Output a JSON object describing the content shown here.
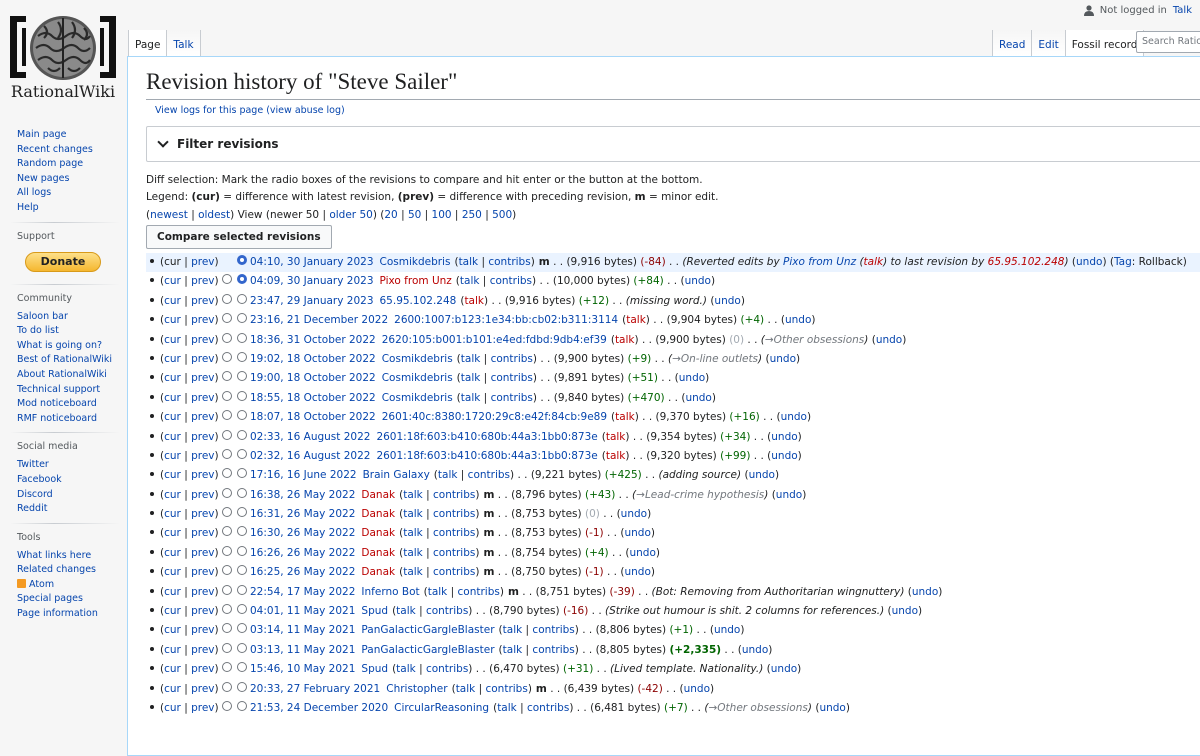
{
  "site": {
    "name": "RationalWiki"
  },
  "personal": {
    "status": "Not logged in",
    "talk": "Talk"
  },
  "tabs_left": [
    {
      "label": "Page",
      "selected": true
    },
    {
      "label": "Talk",
      "selected": false
    }
  ],
  "tabs_right": [
    {
      "label": "Read"
    },
    {
      "label": "Edit"
    },
    {
      "label": "Fossil record",
      "selected": true
    }
  ],
  "search": {
    "placeholder": "Search RationalWiki"
  },
  "sidebar": {
    "nav": [
      "Main page",
      "Recent changes",
      "Random page",
      "New pages",
      "All logs",
      "Help"
    ],
    "support": {
      "head": "Support",
      "donate": "Donate"
    },
    "community": {
      "head": "Community",
      "items": [
        "Saloon bar",
        "To do list",
        "What is going on?",
        "Best of RationalWiki",
        "About RationalWiki",
        "Technical support",
        "Mod noticeboard",
        "RMF noticeboard"
      ]
    },
    "social": {
      "head": "Social media",
      "items": [
        "Twitter",
        "Facebook",
        "Discord",
        "Reddit"
      ]
    },
    "tools": {
      "head": "Tools",
      "items": [
        "What links here",
        "Related changes",
        "Atom",
        "Special pages",
        "Page information"
      ]
    }
  },
  "content": {
    "title": "Revision history of \"Steve Sailer\"",
    "view_logs": "View logs for this page",
    "view_abuse": "(view abuse log)",
    "filter": "Filter revisions",
    "diff_selection": "Diff selection: Mark the radio boxes of the revisions to compare and hit enter or the button at the bottom.",
    "legend_prefix": "Legend: ",
    "legend_cur": "(cur)",
    "legend_cur_text": " = difference with latest revision, ",
    "legend_prev": "(prev)",
    "legend_prev_text": " = difference with preceding revision, ",
    "legend_m": "m",
    "legend_m_text": " = minor edit.",
    "nav": {
      "newest": "newest",
      "oldest": "oldest",
      "view_prefix": " View (newer 50 | ",
      "older": "older 50",
      "view_suffix": ") (",
      "sizes": [
        "20",
        "50",
        "100",
        "250",
        "500"
      ]
    },
    "compare_button": "Compare selected revisions"
  },
  "labels": {
    "cur": "cur",
    "prev": "prev",
    "talk": "talk",
    "contribs": "contribs",
    "undo": "undo",
    "minor": "m",
    "tag": "Tag",
    "rollback": "Rollback"
  },
  "revisions": [
    {
      "ts": "04:10, 30 January 2023",
      "user": "Cosmikdebris",
      "red": false,
      "ip": false,
      "minor": true,
      "bytes": "(9,916 bytes)",
      "diff": "(-84)",
      "dtype": "neg",
      "summary": "Reverted edits by",
      "summary_user": "Pixo from Unz",
      "summary_talk": "talk",
      "summary_to": "to last revision by",
      "summary_rev": "65.95.102.248",
      "tag": true,
      "first": true,
      "r1": true,
      "r2": false,
      "no_cur": true,
      "no_prev": false
    },
    {
      "ts": "04:09, 30 January 2023",
      "user": "Pixo from Unz",
      "red": true,
      "ip": false,
      "minor": false,
      "bytes": "(10,000 bytes)",
      "diff": "(+84)",
      "dtype": "pos",
      "summary": "",
      "r1": false,
      "r2": true
    },
    {
      "ts": "23:47, 29 January 2023",
      "user": "65.95.102.248",
      "red": false,
      "ip": true,
      "minor": false,
      "bytes": "(9,916 bytes)",
      "diff": "(+12)",
      "dtype": "pos",
      "summary": "missing word."
    },
    {
      "ts": "23:16, 21 December 2022",
      "user": "2600:1007:b123:1e34:bb:cb02:b311:3114",
      "red": false,
      "ip": true,
      "minor": false,
      "bytes": "(9,904 bytes)",
      "diff": "(+4)",
      "dtype": "pos",
      "summary": ""
    },
    {
      "ts": "18:36, 31 October 2022",
      "user": "2620:105:b001:b101:e4ed:fdbd:9db4:ef39",
      "red": false,
      "ip": true,
      "minor": false,
      "bytes": "(9,900 bytes)",
      "diff": "(0)",
      "dtype": "null",
      "section": "→Other obsessions"
    },
    {
      "ts": "19:02, 18 October 2022",
      "user": "Cosmikdebris",
      "red": false,
      "ip": false,
      "minor": false,
      "bytes": "(9,900 bytes)",
      "diff": "(+9)",
      "dtype": "pos",
      "section": "→On-line outlets"
    },
    {
      "ts": "19:00, 18 October 2022",
      "user": "Cosmikdebris",
      "red": false,
      "ip": false,
      "minor": false,
      "bytes": "(9,891 bytes)",
      "diff": "(+51)",
      "dtype": "pos",
      "summary": ""
    },
    {
      "ts": "18:55, 18 October 2022",
      "user": "Cosmikdebris",
      "red": false,
      "ip": false,
      "minor": false,
      "bytes": "(9,840 bytes)",
      "diff": "(+470)",
      "dtype": "pos",
      "summary": ""
    },
    {
      "ts": "18:07, 18 October 2022",
      "user": "2601:40c:8380:1720:29c8:e42f:84cb:9e89",
      "red": false,
      "ip": true,
      "minor": false,
      "bytes": "(9,370 bytes)",
      "diff": "(+16)",
      "dtype": "pos",
      "summary": ""
    },
    {
      "ts": "02:33, 16 August 2022",
      "user": "2601:18f:603:b410:680b:44a3:1bb0:873e",
      "red": false,
      "ip": true,
      "minor": false,
      "bytes": "(9,354 bytes)",
      "diff": "(+34)",
      "dtype": "pos",
      "summary": ""
    },
    {
      "ts": "02:32, 16 August 2022",
      "user": "2601:18f:603:b410:680b:44a3:1bb0:873e",
      "red": false,
      "ip": true,
      "minor": false,
      "bytes": "(9,320 bytes)",
      "diff": "(+99)",
      "dtype": "pos",
      "summary": ""
    },
    {
      "ts": "17:16, 16 June 2022",
      "user": "Brain Galaxy",
      "red": false,
      "ip": false,
      "minor": false,
      "bytes": "(9,221 bytes)",
      "diff": "(+425)",
      "dtype": "pos",
      "summary": "adding source"
    },
    {
      "ts": "16:38, 26 May 2022",
      "user": "Danak",
      "red": true,
      "ip": false,
      "minor": true,
      "bytes": "(8,796 bytes)",
      "diff": "(+43)",
      "dtype": "pos",
      "section": "→Lead-crime hypothesis"
    },
    {
      "ts": "16:31, 26 May 2022",
      "user": "Danak",
      "red": true,
      "ip": false,
      "minor": true,
      "bytes": "(8,753 bytes)",
      "diff": "(0)",
      "dtype": "null",
      "summary": ""
    },
    {
      "ts": "16:30, 26 May 2022",
      "user": "Danak",
      "red": true,
      "ip": false,
      "minor": true,
      "bytes": "(8,753 bytes)",
      "diff": "(-1)",
      "dtype": "neg",
      "summary": ""
    },
    {
      "ts": "16:26, 26 May 2022",
      "user": "Danak",
      "red": true,
      "ip": false,
      "minor": true,
      "bytes": "(8,754 bytes)",
      "diff": "(+4)",
      "dtype": "pos",
      "summary": ""
    },
    {
      "ts": "16:25, 26 May 2022",
      "user": "Danak",
      "red": true,
      "ip": false,
      "minor": true,
      "bytes": "(8,750 bytes)",
      "diff": "(-1)",
      "dtype": "neg",
      "summary": ""
    },
    {
      "ts": "22:54, 17 May 2022",
      "user": "Inferno Bot",
      "red": false,
      "ip": false,
      "minor": true,
      "bytes": "(8,751 bytes)",
      "diff": "(-39)",
      "dtype": "neg",
      "summary": "Bot: Removing from Authoritarian wingnuttery"
    },
    {
      "ts": "04:01, 11 May 2021",
      "user": "Spud",
      "red": false,
      "ip": false,
      "minor": false,
      "bytes": "(8,790 bytes)",
      "diff": "(-16)",
      "dtype": "neg",
      "summary": "Strike out humour is shit. 2 columns for references."
    },
    {
      "ts": "03:14, 11 May 2021",
      "user": "PanGalacticGargleBlaster",
      "red": false,
      "ip": false,
      "minor": false,
      "bytes": "(8,806 bytes)",
      "diff": "(+1)",
      "dtype": "pos",
      "summary": ""
    },
    {
      "ts": "03:13, 11 May 2021",
      "user": "PanGalacticGargleBlaster",
      "red": false,
      "ip": false,
      "minor": false,
      "bytes": "(8,805 bytes)",
      "diff": "(+2,335)",
      "dtype": "pos-big",
      "summary": ""
    },
    {
      "ts": "15:46, 10 May 2021",
      "user": "Spud",
      "red": false,
      "ip": false,
      "minor": false,
      "bytes": "(6,470 bytes)",
      "diff": "(+31)",
      "dtype": "pos",
      "summary": "Lived template. Nationality."
    },
    {
      "ts": "20:33, 27 February 2021",
      "user": "Christopher",
      "red": false,
      "ip": false,
      "minor": true,
      "bytes": "(6,439 bytes)",
      "diff": "(-42)",
      "dtype": "neg",
      "summary": ""
    },
    {
      "ts": "21:53, 24 December 2020",
      "user": "CircularReasoning",
      "red": false,
      "ip": false,
      "minor": false,
      "bytes": "(6,481 bytes)",
      "diff": "(+7)",
      "dtype": "pos",
      "section": "→Other obsessions"
    }
  ]
}
